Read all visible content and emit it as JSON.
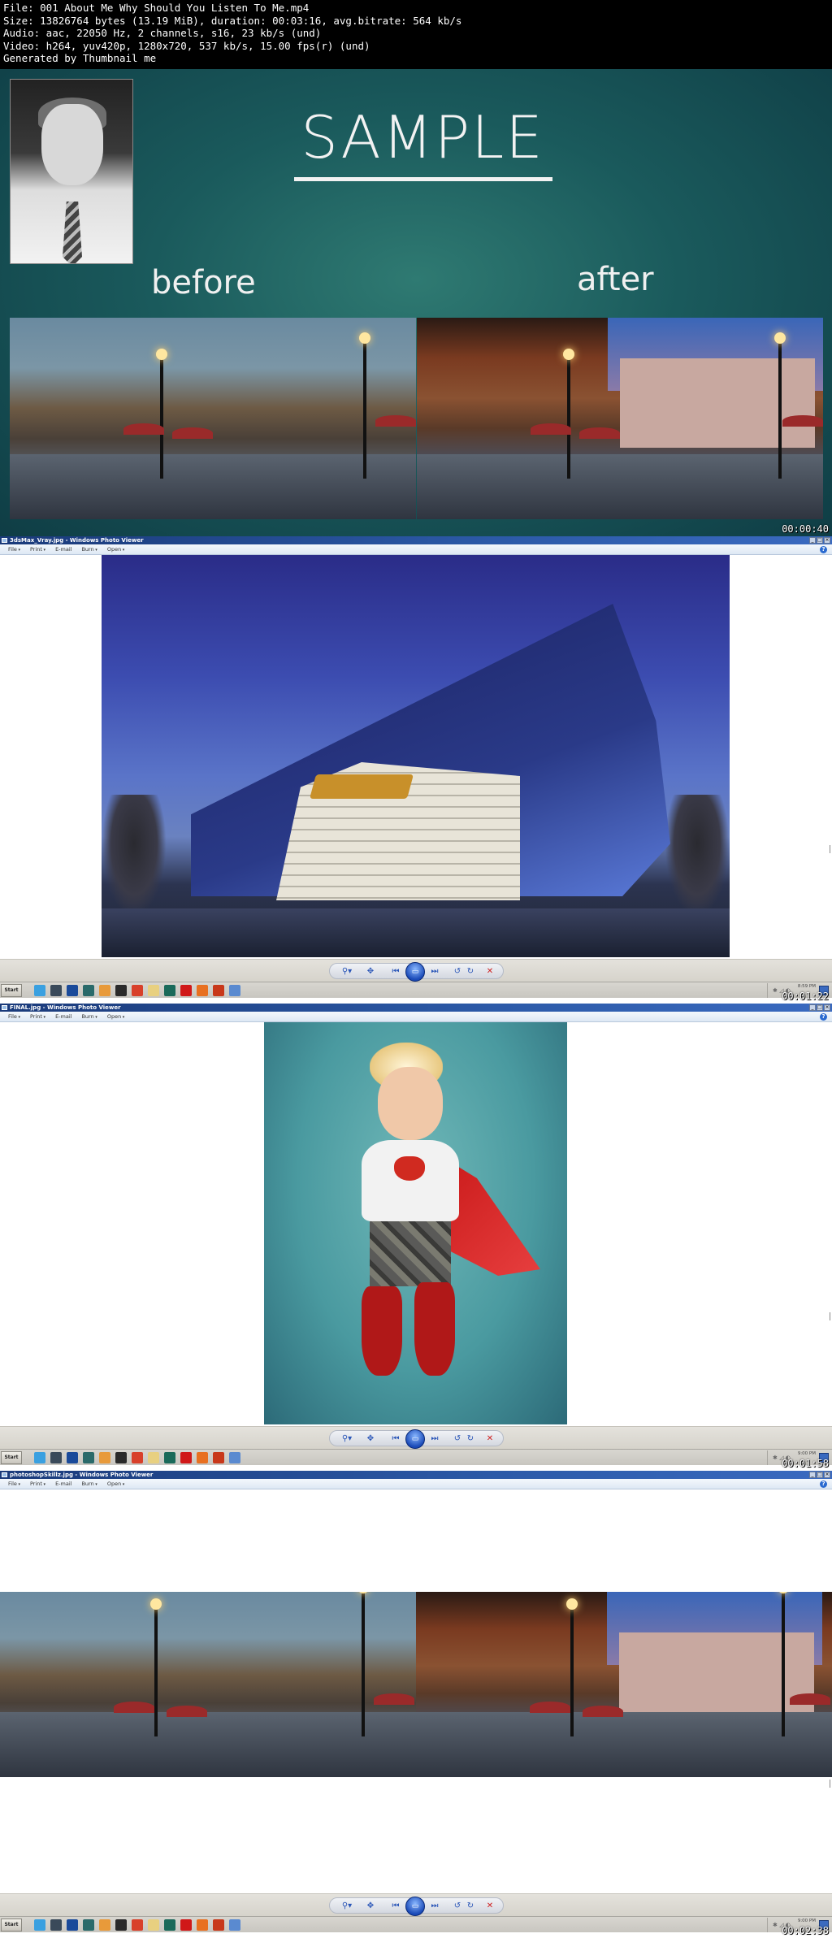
{
  "file_info": {
    "line1": "File: 001 About Me  Why Should You Listen To Me.mp4",
    "line2": "Size: 13826764 bytes (13.19 MiB), duration: 00:03:16, avg.bitrate: 564 kb/s",
    "line3": "Audio: aac, 22050 Hz, 2 channels, s16, 23 kb/s (und)",
    "line4": "Video: h264, yuv420p, 1280x720, 537 kb/s, 15.00 fps(r) (und)",
    "line5": "Generated by Thumbnail me"
  },
  "frames": [
    {
      "timestamp": "00:00:40",
      "slide": {
        "title": "SAMPLE",
        "label_before": "before",
        "label_after": "after",
        "portrait_alt": "presenter portrait (black & white)",
        "image_alt_before": "street scene render before",
        "image_alt_after": "street scene render after"
      }
    },
    {
      "timestamp": "00:01:22",
      "window_title": "3dsMax_Vray.jpg - Windows Photo Viewer",
      "image_alt": "modern glass building render at dusk",
      "clock": "8:59 PM"
    },
    {
      "timestamp": "00:01:58",
      "window_title": "FINAL.jpg - Windows Photo Viewer",
      "image_alt": "cartoon superhero boy character with red cape",
      "clock": "9:00 PM"
    },
    {
      "timestamp": "00:02:38",
      "window_title": "photoshopSkillz.jpg - Windows Photo Viewer",
      "image_alt": "before/after street scene composite",
      "clock": "9:00 PM"
    }
  ],
  "viewer": {
    "menu": [
      "File",
      "Print",
      "E-mail",
      "Burn",
      "Open"
    ],
    "help": "?",
    "window_controls": [
      "_",
      "□",
      "×"
    ],
    "controls": {
      "zoom": "⚲▾",
      "fit": "✥",
      "previous": "⏮",
      "slideshow": "▭",
      "next": "⏭",
      "rotate_ccw": "↺",
      "rotate_cw": "↻",
      "delete": "✕"
    }
  },
  "taskbar": {
    "start_label": "Start",
    "icons": [
      {
        "name": "ie-icon",
        "color": "#3aa0e0"
      },
      {
        "name": "media-center-icon",
        "color": "#3a4a5a"
      },
      {
        "name": "task-check-icon",
        "color": "#1a4a9a"
      },
      {
        "name": "maya-icon",
        "color": "#2a6a6a"
      },
      {
        "name": "media-player-icon",
        "color": "#e89a3a"
      },
      {
        "name": "3dsmax-icon",
        "color": "#2a2a2a"
      },
      {
        "name": "chrome-icon",
        "color": "#d8402a"
      },
      {
        "name": "explorer-folder-icon",
        "color": "#e8d080"
      },
      {
        "name": "project-app-icon",
        "color": "#1a6a5a"
      },
      {
        "name": "acrobat-icon",
        "color": "#d01818"
      },
      {
        "name": "firefox-icon",
        "color": "#e87020"
      },
      {
        "name": "powerpoint-icon",
        "color": "#c8381a"
      },
      {
        "name": "photo-viewer-icon",
        "color": "#5a8ad0"
      }
    ],
    "tray_icons": "✱ ◿ ◐"
  },
  "colors": {
    "slide_bg": "#1a5a5c",
    "titlebar": "#2c5aa8",
    "taskbar": "#d0cec8"
  }
}
